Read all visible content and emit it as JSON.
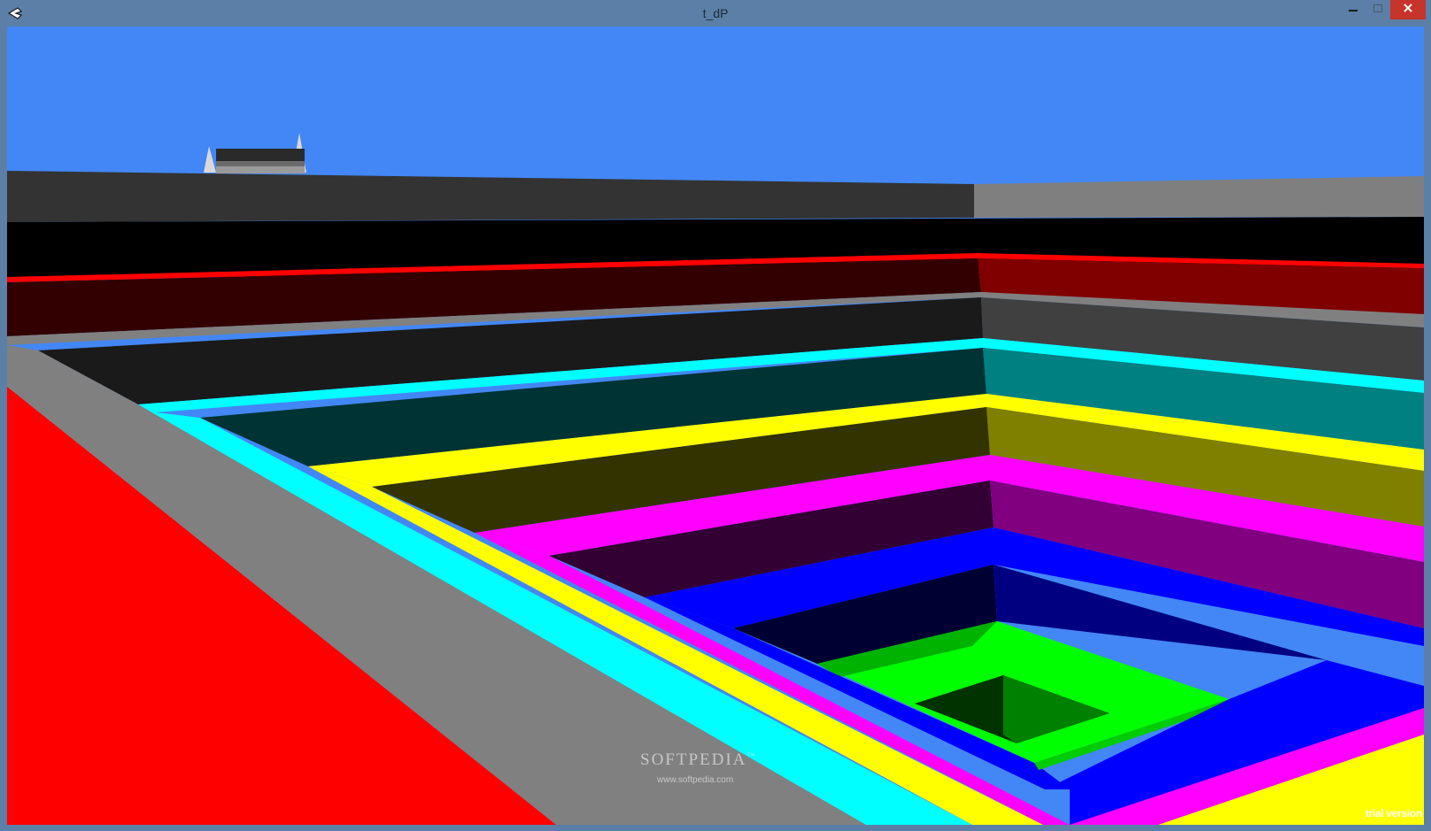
{
  "window": {
    "title": "t_dP",
    "icons": [
      "unity-app-icon",
      "minimize-icon",
      "maximize-icon",
      "close-icon"
    ]
  },
  "scene": {
    "watermark": {
      "text": "SOFTPEDIA",
      "trademark": "™",
      "url": "www.softpedia.com"
    },
    "overlay_label": "trial version",
    "colors": {
      "sky": "#4287f5",
      "red": "#ff0000",
      "gray": "#808080",
      "cyan": "#00ffff",
      "yellow": "#ffff00",
      "magenta": "#ff00ff",
      "blue": "#0000ff",
      "green": "#00ff00",
      "black": "#000000"
    }
  }
}
